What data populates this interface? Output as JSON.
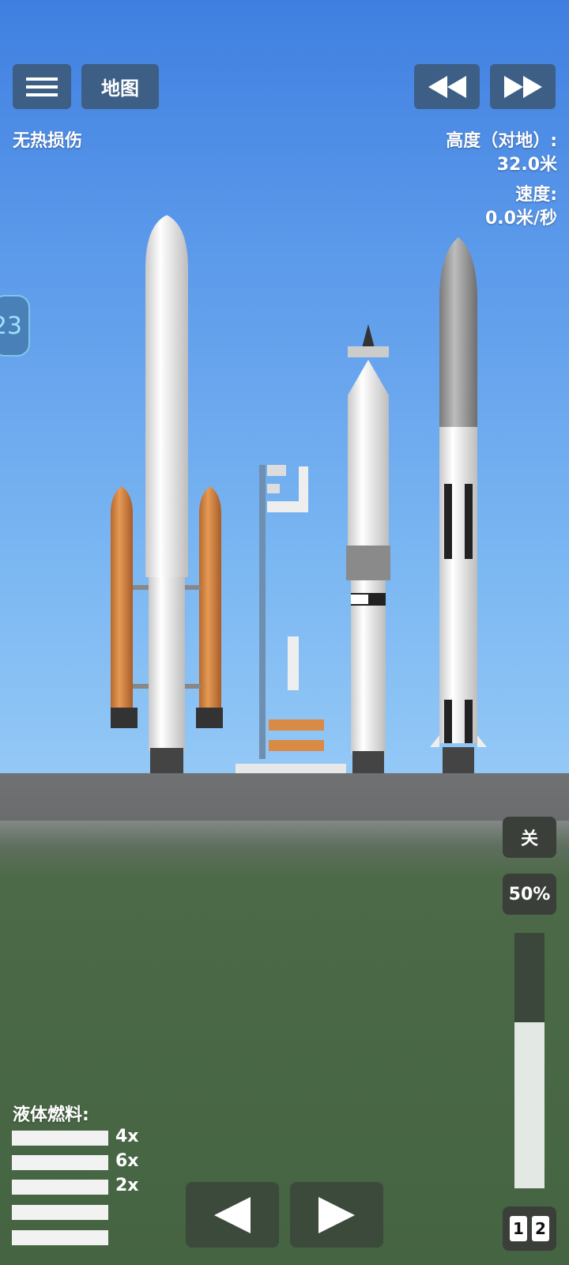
{
  "toolbar": {
    "menu_icon": "hamburger-menu-icon",
    "map_label": "地图",
    "rewind_icon": "rewind-icon",
    "fast_forward_icon": "fast-forward-icon"
  },
  "status": {
    "heat": "无热损伤",
    "altitude_label": "高度（对地）:",
    "altitude_value": "32.0米",
    "speed_label": "速度:",
    "speed_value": "0.0米/秒"
  },
  "side_tab": {
    "label": "23"
  },
  "controls": {
    "toggle_label": "关",
    "throttle_label": "50%",
    "throttle_fraction": 0.65,
    "prev_icon": "left-arrow-icon",
    "next_icon": "right-arrow-icon",
    "stage_a": "1",
    "stage_b": "2"
  },
  "fuel": {
    "title": "液体燃料:",
    "rows": [
      "4x",
      "6x",
      "2x",
      "",
      ""
    ]
  },
  "colors": {
    "button_blue": "#3d5f86",
    "booster_orange": "#d98a45",
    "ground_gray": "#6f7173"
  }
}
